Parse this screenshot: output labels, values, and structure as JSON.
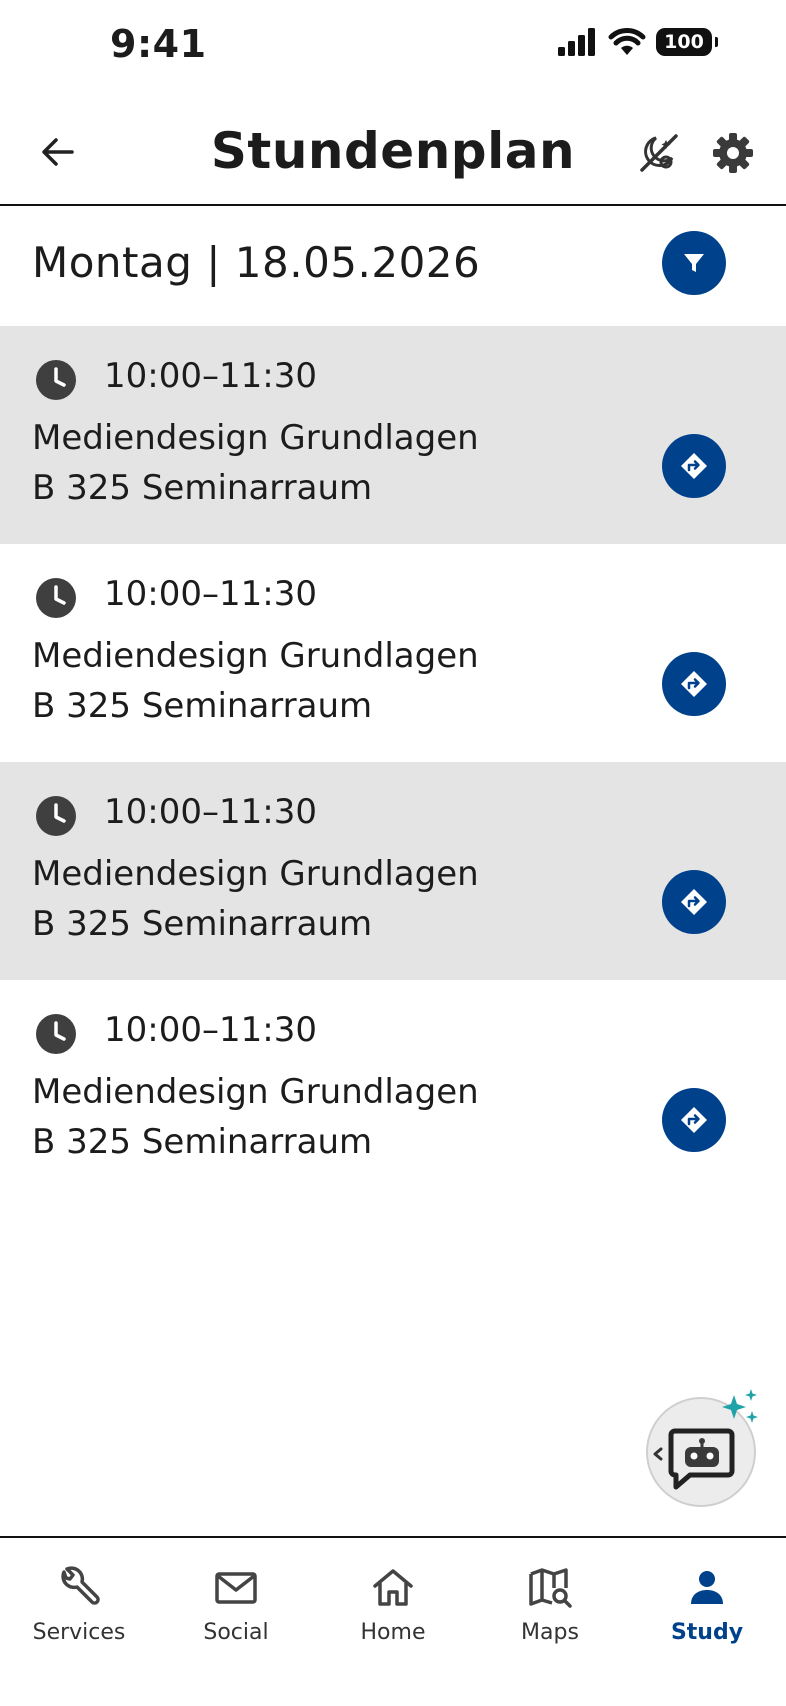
{
  "status_bar": {
    "time": "9:41",
    "battery": "100"
  },
  "header": {
    "title": "Stundenplan"
  },
  "date_label": "Montag | 18.05.2026",
  "schedule": [
    {
      "time": "10:00–11:30",
      "course": "Mediendesign Grundlagen",
      "room": "B 325 Seminarraum"
    },
    {
      "time": "10:00–11:30",
      "course": "Mediendesign Grundlagen",
      "room": "B 325 Seminarraum"
    },
    {
      "time": "10:00–11:30",
      "course": "Mediendesign Grundlagen",
      "room": "B 325 Seminarraum"
    },
    {
      "time": "10:00–11:30",
      "course": "Mediendesign Grundlagen",
      "room": "B 325 Seminarraum"
    }
  ],
  "bottom_nav": [
    {
      "label": "Services",
      "icon": "wrench-icon"
    },
    {
      "label": "Social",
      "icon": "mail-icon"
    },
    {
      "label": "Home",
      "icon": "home-icon"
    },
    {
      "label": "Maps",
      "icon": "map-search-icon"
    },
    {
      "label": "Study",
      "icon": "person-icon",
      "active": true
    }
  ],
  "colors": {
    "accent": "#00418c",
    "row_shade": "#e4e4e4",
    "sparkle": "#1fa3a8"
  }
}
